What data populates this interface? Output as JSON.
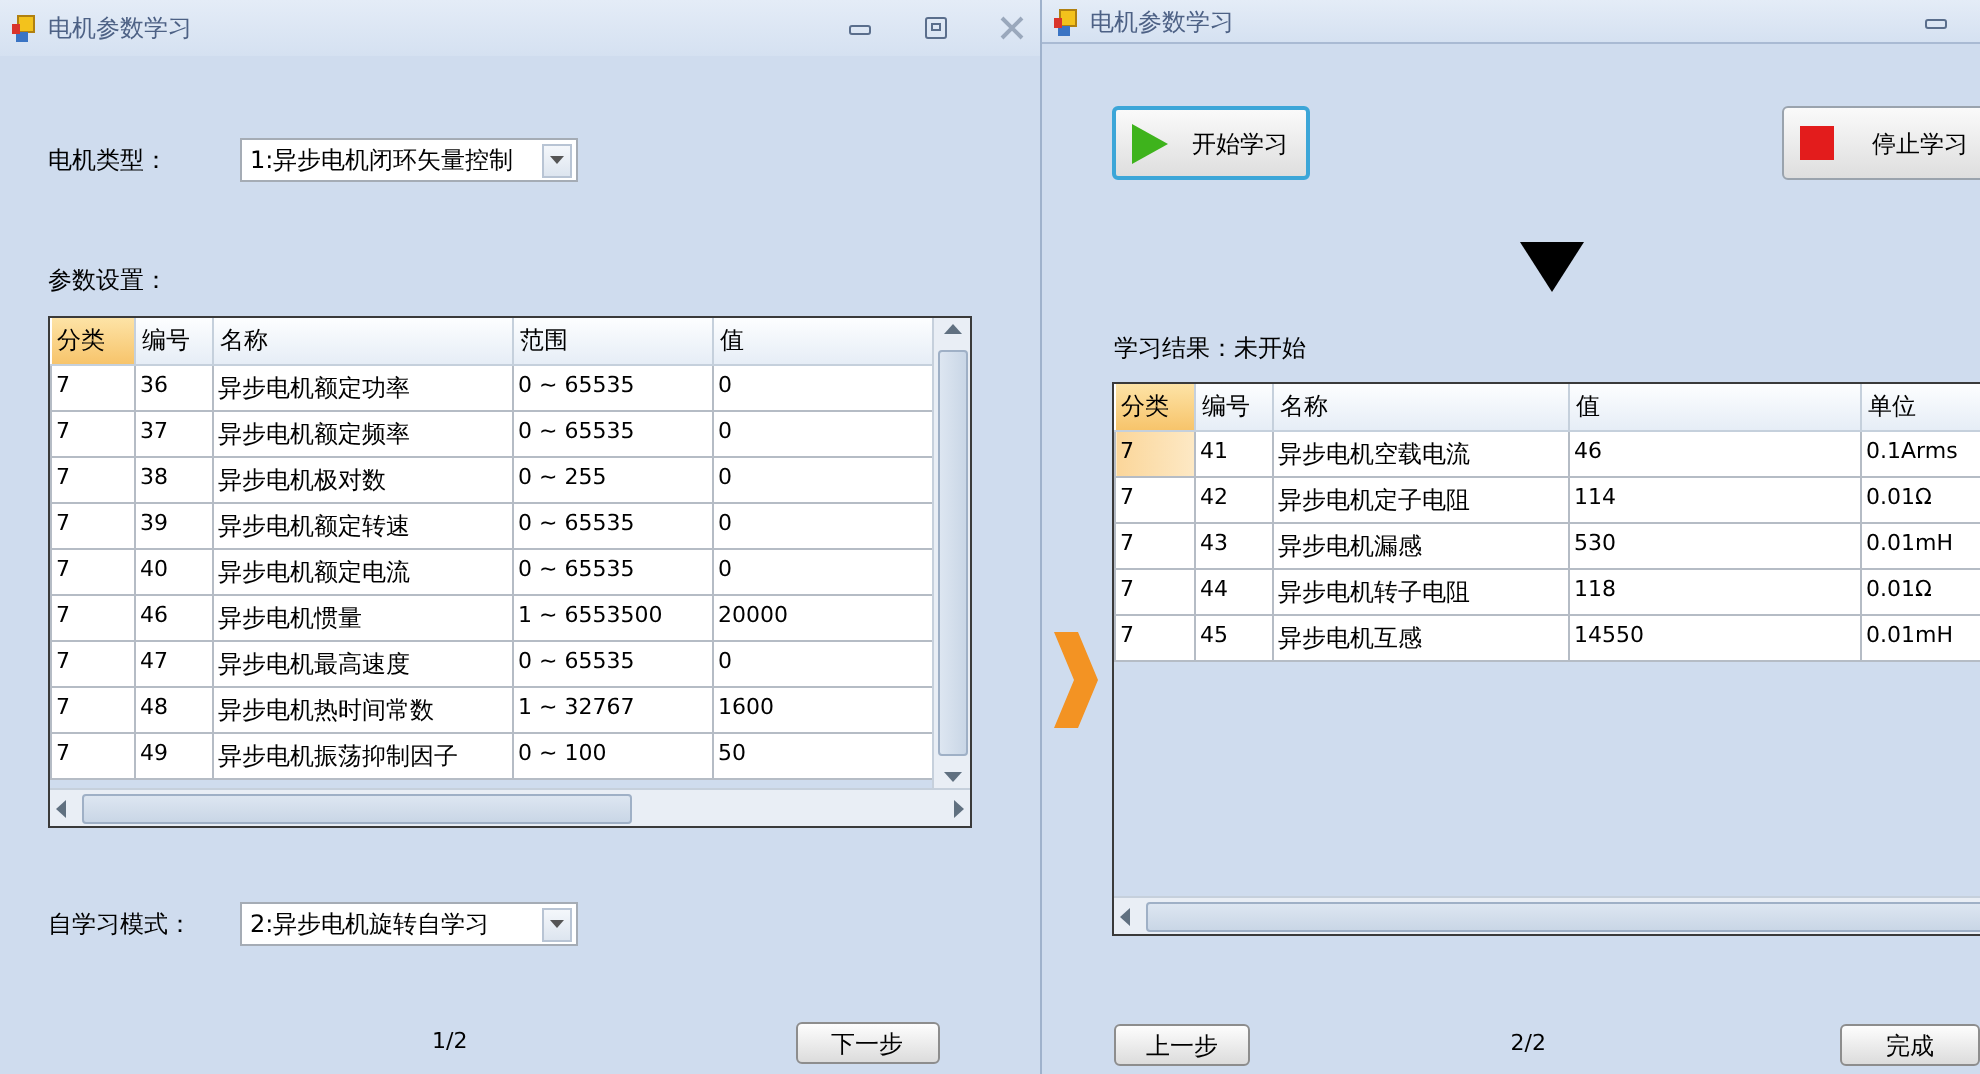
{
  "left_window": {
    "title": "电机参数学习",
    "motor_type": {
      "label": "电机类型：",
      "value": "1:异步电机闭环矢量控制"
    },
    "params_label": "参数设置：",
    "table": {
      "columns": [
        {
          "label": "分类",
          "highlighted": true
        },
        {
          "label": "编号",
          "highlighted": false
        },
        {
          "label": "名称",
          "highlighted": false
        },
        {
          "label": "范围",
          "highlighted": false
        },
        {
          "label": "值",
          "highlighted": false
        }
      ],
      "rows": [
        {
          "cells": [
            "7",
            "36",
            "异步电机额定功率",
            "0 ~ 65535",
            "0"
          ],
          "selected": false
        },
        {
          "cells": [
            "7",
            "37",
            "异步电机额定频率",
            "0 ~ 65535",
            "0"
          ],
          "selected": false
        },
        {
          "cells": [
            "7",
            "38",
            "异步电机极对数",
            "0 ~ 255",
            "0"
          ],
          "selected": false
        },
        {
          "cells": [
            "7",
            "39",
            "异步电机额定转速",
            "0 ~ 65535",
            "0"
          ],
          "selected": false
        },
        {
          "cells": [
            "7",
            "40",
            "异步电机额定电流",
            "0 ~ 65535",
            "0"
          ],
          "selected": false
        },
        {
          "cells": [
            "7",
            "46",
            "异步电机惯量",
            "1 ~ 6553500",
            "20000"
          ],
          "selected": false
        },
        {
          "cells": [
            "7",
            "47",
            "异步电机最高速度",
            "0 ~ 65535",
            "0"
          ],
          "selected": false
        },
        {
          "cells": [
            "7",
            "48",
            "异步电机热时间常数",
            "1 ~ 32767",
            "1600"
          ],
          "selected": false
        },
        {
          "cells": [
            "7",
            "49",
            "异步电机振荡抑制因子",
            "0 ~ 100",
            "50"
          ],
          "selected": false
        }
      ]
    },
    "mode": {
      "label": "自学习模式：",
      "value": "2:异步电机旋转自学习"
    },
    "page": "1/2",
    "next_button": "下一步"
  },
  "right_window": {
    "title": "电机参数学习",
    "start_button": "开始学习",
    "stop_button": "停止学习",
    "result": "学习结果：未开始",
    "table": {
      "columns": [
        {
          "label": "分类",
          "highlighted": true
        },
        {
          "label": "编号",
          "highlighted": false
        },
        {
          "label": "名称",
          "highlighted": false
        },
        {
          "label": "值",
          "highlighted": false
        },
        {
          "label": "单位",
          "highlighted": false
        }
      ],
      "rows": [
        {
          "cells": [
            "7",
            "41",
            "异步电机空载电流",
            "46",
            "0.1Arms"
          ],
          "selected": true
        },
        {
          "cells": [
            "7",
            "42",
            "异步电机定子电阻",
            "114",
            "0.01Ω"
          ],
          "selected": false
        },
        {
          "cells": [
            "7",
            "43",
            "异步电机漏感",
            "530",
            "0.01mH"
          ],
          "selected": false
        },
        {
          "cells": [
            "7",
            "44",
            "异步电机转子电阻",
            "118",
            "0.01Ω"
          ],
          "selected": false
        },
        {
          "cells": [
            "7",
            "45",
            "异步电机互感",
            "14550",
            "0.01mH"
          ],
          "selected": false
        }
      ]
    },
    "prev_button": "上一步",
    "page": "2/2",
    "finish_button": "完成"
  }
}
